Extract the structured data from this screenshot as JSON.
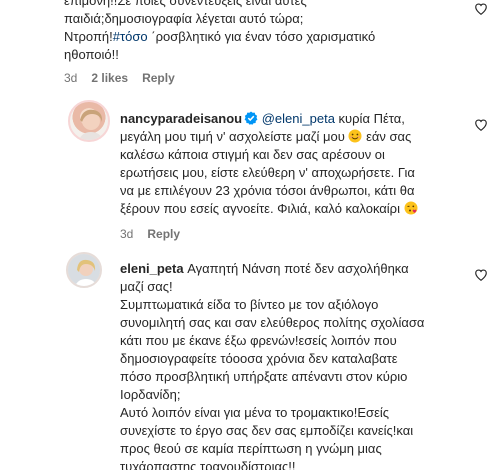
{
  "comment0": {
    "line1": "επιμονή!!Σε ποιες συνεντεύξεις είναι αυτές",
    "line2": "παιδιά;δημοσιογραφία λέγεται αυτό τώρα;",
    "line3_a": "Ντροπή!",
    "line3_hashtag": "#τόσο",
    "line3_b": " ΄ροσβλητικό για έναν τόσο χαρισματικό",
    "line4": "ηθοποιό!!",
    "time": "3d",
    "likes": "2 likes",
    "reply": "Reply"
  },
  "comment1": {
    "username": "nancyparadeisanou",
    "mention": "@eleni_peta",
    "line1_rest": " κυρία Πέτα,",
    "line2": "μεγάλη μου τιμή ν' ασχολείστε μαζί μου",
    "line2_b": " εάν σας",
    "line3": "καλέσω κάποια στιγμή και δεν σας αρέσουν οι",
    "line4": "ερωτήσεις μου, είστε ελεύθερη ν' αποχωρήσετε. Για",
    "line5": "να με επιλέγουν 23 χρόνια τόσοι άνθρωποι, κάτι θα",
    "line6": "ξέρουν που εσείς αγνοείτε. Φιλιά, καλό καλοκαίρι",
    "time": "3d",
    "reply": "Reply"
  },
  "comment2": {
    "username": "eleni_peta",
    "line1_rest": " Αγαπητή Νάνση ποτέ δεν ασχολήθηκα",
    "line2": "μαζί σας!",
    "line3": "Συμπτωματικά είδα το βίντεο με τον αξιόλογο",
    "line4": "συνομιλητή σας και σαν ελεύθερος πολίτης σχολίασα",
    "line5": "κάτι που με έκανε έξω φρενών!εσείς λοιπόν που",
    "line6": "δημοσιογραφείτε τόοοσα χρόνια δεν καταλαβατε",
    "line7": "πόσο προσβλητική υπήρξατε απέναντι στον κύριο",
    "line8": "Ιορδανίδη;",
    "line9": "Αυτό λοιπόν είναι για μένα το τρομακτικο!Εσείς",
    "line10": "συνεχίστε το έργο σας δεν σας εμποδίζει κανείς!και",
    "line11": "προς θεού σε καμία περίπτωση η γνώμη μιας",
    "line12": "τυχάρπαστης τραγουδίστριας!!"
  },
  "icons": {
    "heart": "heart-outline-icon",
    "verified": "verified-badge-icon",
    "smile": "smiling-face-emoji",
    "kiss": "face-blowing-kiss-emoji"
  },
  "colors": {
    "link": "#00376b",
    "meta": "#737373",
    "verified": "#0095f6"
  }
}
